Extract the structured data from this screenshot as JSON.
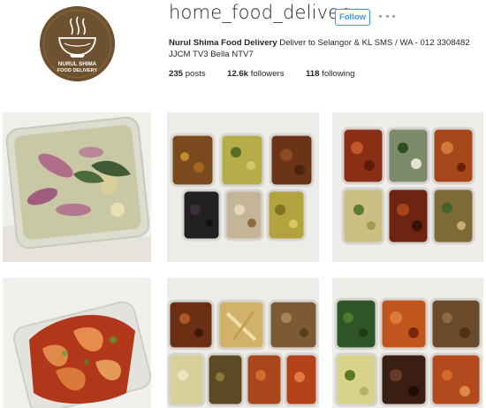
{
  "profile": {
    "username": "home_food_delivery",
    "follow_label": "Follow",
    "more_icon": "ellipsis-icon",
    "avatar": {
      "logo_line1": "NURUL SHIMA",
      "logo_line2": "FOOD DELIVERY",
      "icon": "steaming-bowl-icon"
    },
    "bio": {
      "name": "Nurul Shima Food Delivery",
      "text": "Deliver to Selangor & KL SMS / WA - 012 3308482",
      "line2": "JJCM TV3 Bella NTV7"
    },
    "stats": {
      "posts_count": "235",
      "posts_label": "posts",
      "followers_count": "12.6k",
      "followers_label": "followers",
      "following_count": "118",
      "following_label": "following"
    }
  },
  "colors": {
    "follow_blue": "#3897f0",
    "avatar_brown": "#6e5230"
  },
  "posts": [
    {
      "description": "squid-curry-post"
    },
    {
      "description": "six-container-meal-post"
    },
    {
      "description": "six-container-seafood-post"
    },
    {
      "description": "prawn-sambal-post"
    },
    {
      "description": "eight-container-meal-post"
    },
    {
      "description": "six-container-vegetable-post"
    }
  ]
}
